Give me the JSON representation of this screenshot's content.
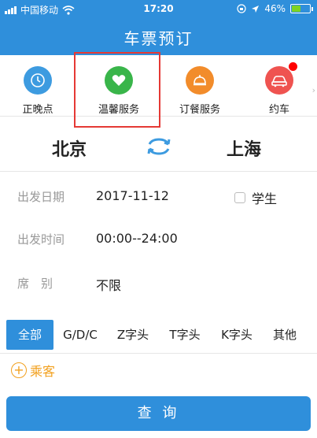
{
  "status_bar": {
    "carrier": "中国移动",
    "time": "17:20",
    "battery": "46%",
    "battery_level": 0.46,
    "icons": [
      "signal-icon",
      "wifi-icon",
      "lock-rotation-icon",
      "location-arrow-icon",
      "battery-icon"
    ]
  },
  "nav": {
    "title": "车票预订"
  },
  "services": [
    {
      "label": "正晚点",
      "icon": "clock-icon",
      "color": "#3d9be0"
    },
    {
      "label": "温馨服务",
      "icon": "heart-icon",
      "color": "#39b54a"
    },
    {
      "label": "订餐服务",
      "icon": "food-cover-icon",
      "color": "#f28c2b"
    },
    {
      "label": "约车",
      "icon": "car-icon",
      "color": "#ef5350",
      "badge": true
    }
  ],
  "route": {
    "from": "北京",
    "to": "上海",
    "swap_icon": "swap-icon"
  },
  "date_row": {
    "label": "出发日期",
    "value": "2017-11-12",
    "student_label": "学生"
  },
  "time_row": {
    "label": "出发时间",
    "value": "00:00--24:00"
  },
  "seat_row": {
    "label": "席　别",
    "value": "不限"
  },
  "train_types": [
    "全部",
    "G/D/C",
    "Z字头",
    "T字头",
    "K字头",
    "其他"
  ],
  "passenger": {
    "label": "乘客",
    "icon": "plus-circle-icon"
  },
  "query_button": {
    "label": "查 询"
  },
  "colors": {
    "primary": "#2f8fdb",
    "accent": "#f2a01e",
    "highlight": "#e53935"
  }
}
